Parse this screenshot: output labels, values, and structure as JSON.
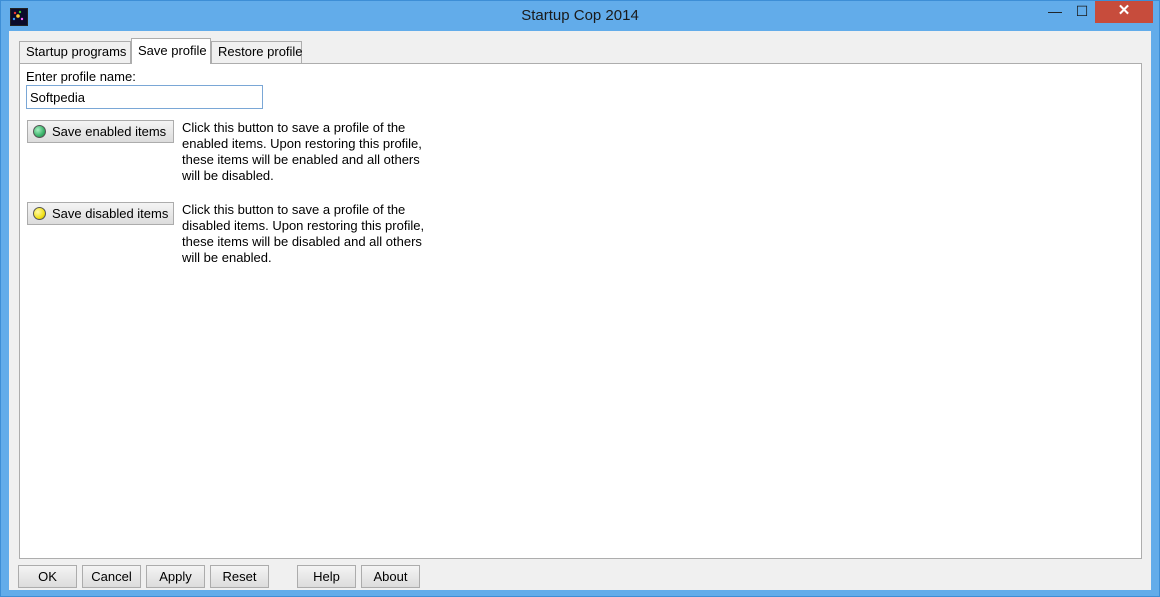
{
  "window": {
    "title": "Startup Cop 2014",
    "controls": {
      "minimize": "—",
      "maximize": "☐",
      "close": "✕"
    }
  },
  "tabs": [
    {
      "label": "Startup programs",
      "active": false
    },
    {
      "label": "Save profile",
      "active": true
    },
    {
      "label": "Restore profile",
      "active": false
    }
  ],
  "save_profile": {
    "name_label": "Enter profile name:",
    "name_value": "Softpedia",
    "enabled_button": {
      "label": "Save enabled items",
      "icon": "green-dot-icon",
      "color": "#3bb36a",
      "description": "Click this button to save a profile of the enabled items. Upon restoring this profile, these items will be enabled and all others will be disabled."
    },
    "disabled_button": {
      "label": "Save disabled items",
      "icon": "yellow-dot-icon",
      "color": "#f2e21a",
      "description": "Click this button to save a profile of the disabled items. Upon restoring this profile, these items will be disabled and all others will be enabled."
    }
  },
  "footer": {
    "ok": "OK",
    "cancel": "Cancel",
    "apply": "Apply",
    "reset": "Reset",
    "help": "Help",
    "about": "About"
  },
  "colors": {
    "titlebar": "#62acea",
    "close_button": "#c74c3c"
  }
}
